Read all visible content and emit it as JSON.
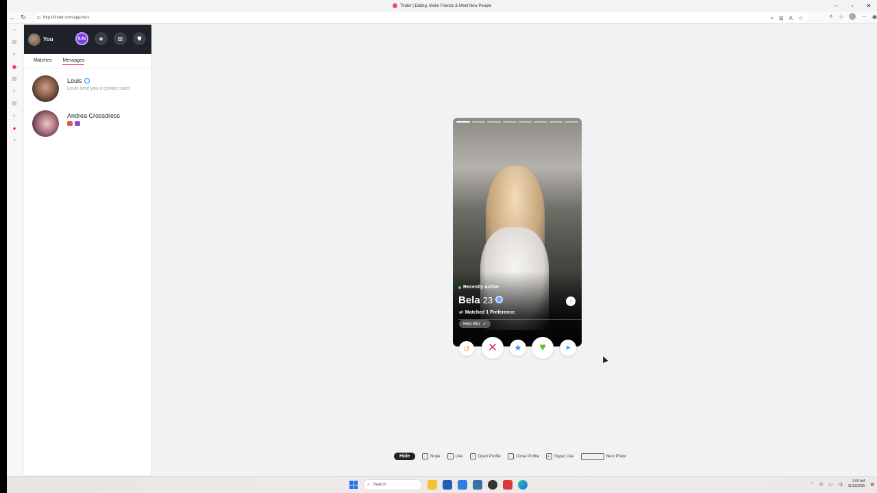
{
  "browser": {
    "tab_title": "Tinder | Dating, Make Friends & Meet New People",
    "url": "http://tinder.com/app/recs"
  },
  "sidebar": {
    "user_label": "You",
    "boost_label": "9.4x",
    "tabs": [
      {
        "label": "Matches",
        "active": false
      },
      {
        "label": "Messages",
        "active": true
      }
    ],
    "conversations": [
      {
        "name": "Louis",
        "preview": "Louis sent you a contact card",
        "verified": true
      },
      {
        "name": "Andrea Crossdress",
        "preview": "",
        "verified": false
      }
    ]
  },
  "profile": {
    "status": "Recently Active",
    "name": "Bela",
    "age": "23",
    "verified": true,
    "preference": "Matched 1 Preference",
    "badge": "Has Bio",
    "photo_count": 8,
    "current_photo": 1
  },
  "shortcuts": {
    "hide_label": "Hide",
    "items": [
      {
        "key": "←",
        "label": "Nope"
      },
      {
        "key": "→",
        "label": "Like"
      },
      {
        "key": "↑",
        "label": "Open Profile"
      },
      {
        "key": "↓",
        "label": "Close Profile"
      },
      {
        "key": "↵",
        "label": "Super Like"
      }
    ],
    "next_photo_label": "Next Photo"
  },
  "taskbar": {
    "search_placeholder": "Search",
    "time": "2:09 AM",
    "date": "11/23/2025"
  },
  "colors": {
    "tinder_pink": "#e3296b",
    "like_green": "#58c322",
    "super_blue": "#2f8cff",
    "rewind_gold": "#f0a500"
  }
}
